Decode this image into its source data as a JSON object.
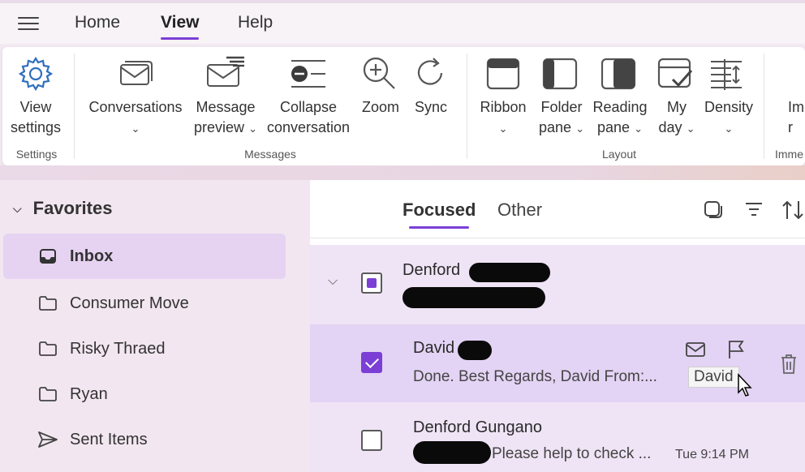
{
  "menu": {
    "tabs": [
      {
        "label": "Home",
        "active": false
      },
      {
        "label": "View",
        "active": true
      },
      {
        "label": "Help",
        "active": false
      }
    ]
  },
  "ribbon": {
    "settings": {
      "view_settings": [
        "View",
        "settings"
      ],
      "group_label": "Settings"
    },
    "messages": {
      "conversations": "Conversations",
      "message_preview": [
        "Message",
        "preview"
      ],
      "collapse_conversation": [
        "Collapse",
        "conversation"
      ],
      "zoom": "Zoom",
      "sync": "Sync",
      "group_label": "Messages"
    },
    "layout": {
      "ribbon": "Ribbon",
      "folder_pane": [
        "Folder",
        "pane"
      ],
      "reading_pane": [
        "Reading",
        "pane"
      ],
      "my_day": [
        "My",
        "day"
      ],
      "density": "Density",
      "group_label": "Layout"
    },
    "overflow": {
      "label_fragment": [
        "Im",
        "r"
      ],
      "group_fragment": "Imme"
    }
  },
  "nav": {
    "favorites_label": "Favorites",
    "items": [
      {
        "label": "Inbox",
        "icon": "inbox-icon",
        "selected": true
      },
      {
        "label": "Consumer Move",
        "icon": "folder-icon",
        "selected": false
      },
      {
        "label": "Risky Thraed",
        "icon": "folder-icon",
        "selected": false
      },
      {
        "label": "Ryan",
        "icon": "folder-icon",
        "selected": false
      },
      {
        "label": "Sent Items",
        "icon": "send-icon",
        "selected": false
      }
    ]
  },
  "inbox_tabs": {
    "focused": "Focused",
    "other": "Other"
  },
  "messages": [
    {
      "sender": "Denford",
      "preview": "",
      "selected": "partial"
    },
    {
      "sender": "David",
      "preview": "Done. Best Regards, David From:...",
      "selected": "checked",
      "tooltip": "David"
    },
    {
      "sender": "Denford Gungano",
      "preview": "Please help to check ...",
      "time": "Tue 9:14 PM",
      "selected": "none"
    }
  ],
  "colors": {
    "accent": "#7b3fd6",
    "selected_nav": "#e6d3f2",
    "selected_row": "#e3d3f4"
  }
}
